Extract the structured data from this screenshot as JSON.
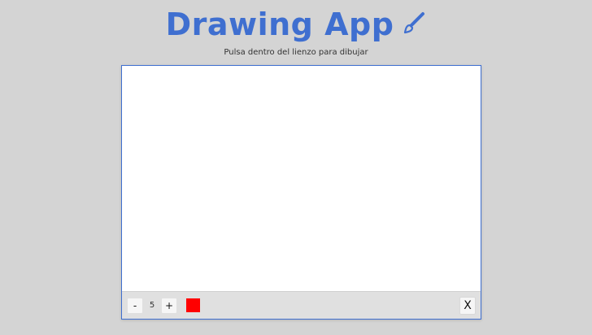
{
  "header": {
    "title": "Drawing App",
    "icon": "paintbrush-icon",
    "accent_color": "#3f6fd0"
  },
  "hint": "Pulsa dentro del lienzo para dibujar",
  "toolbox": {
    "decrease_label": "-",
    "size_value": "5",
    "increase_label": "+",
    "current_color": "#ff0000",
    "clear_label": "X"
  }
}
